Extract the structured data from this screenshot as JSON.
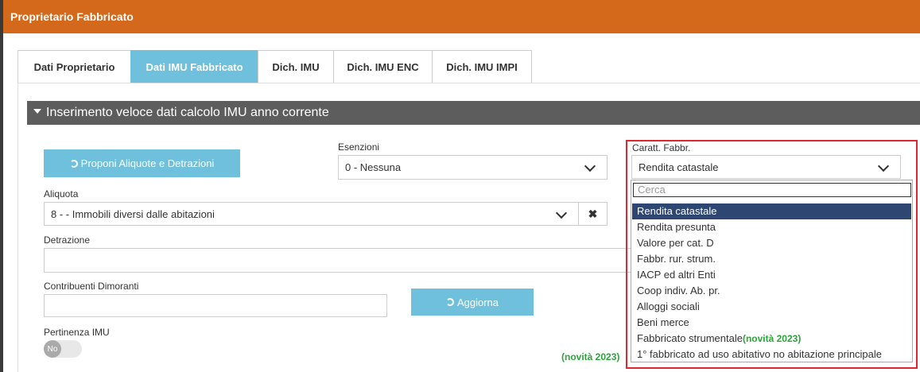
{
  "modal": {
    "title": "Proprietario Fabbricato"
  },
  "tabs": [
    {
      "label": "Dati Proprietario"
    },
    {
      "label": "Dati IMU Fabbricato"
    },
    {
      "label": "Dich. IMU"
    },
    {
      "label": "Dich. IMU ENC"
    },
    {
      "label": "Dich. IMU IMPI"
    }
  ],
  "section": {
    "title": "Inserimento veloce dati calcolo IMU anno corrente"
  },
  "form": {
    "proponi_label": "Proponi Aliquote e Detrazioni",
    "esenzioni_label": "Esenzioni",
    "esenzioni_value": "0 - Nessuna",
    "caratt_label": "Caratt. Fabbr.",
    "caratt_value": "Rendita catastale",
    "aliquota_label": "Aliquota",
    "aliquota_value": "8 - - Immobili diversi dalle abitazioni",
    "clear_symbol": "✖",
    "detrazione_label": "Detrazione",
    "contribuenti_label": "Contribuenti Dimoranti",
    "aggiorna_label": "Aggiorna",
    "pertinenza_label": "Pertinenza IMU",
    "toggle_text": "No",
    "novita_note": "(novità 2023)"
  },
  "dropdown": {
    "search_placeholder": "Cerca",
    "options": [
      "Rendita catastale",
      "Rendita presunta",
      "Valore per cat. D",
      "Fabbr. rur. strum.",
      "IACP ed altri Enti",
      "Coop indiv. Ab. pr.",
      "Alloggi sociali",
      "Beni merce",
      "Fabbricato strumentale",
      "1° fabbricato ad uso abitativo no abitazione principale"
    ],
    "option_note": "(novità 2023)"
  },
  "colors": {
    "header": "#d4691c",
    "accent": "#6fc0dc",
    "selected": "#2d4672",
    "highlight_border": "#e0262e",
    "note_green": "#2aa53a"
  }
}
